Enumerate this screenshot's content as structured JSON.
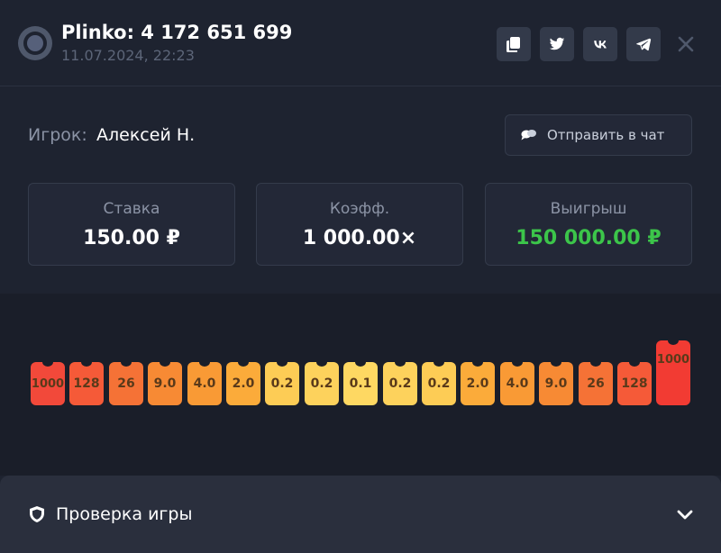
{
  "header": {
    "title": "Plinko: 4 172 651 699",
    "date": "11.07.2024, 22:23",
    "actions": [
      {
        "icon": "copy-icon"
      },
      {
        "icon": "twitter-icon"
      },
      {
        "icon": "vk-icon"
      },
      {
        "icon": "telegram-icon"
      }
    ],
    "close_icon": "close-icon"
  },
  "player": {
    "label": "Игрок:",
    "name": "Алексей Н.",
    "send_button": "Отправить в чат"
  },
  "stats": [
    {
      "label": "Ставка",
      "value": "150.00 ₽"
    },
    {
      "label": "Коэфф.",
      "value": "1 000.00×"
    },
    {
      "label": "Выигрыш",
      "value": "150 000.00 ₽"
    }
  ],
  "board": {
    "multipliers": [
      "1000",
      "128",
      "26",
      "9.0",
      "4.0",
      "2.0",
      "0.2",
      "0.2",
      "0.1",
      "0.2",
      "0.2",
      "2.0",
      "4.0",
      "9.0",
      "26",
      "128",
      "1000"
    ],
    "slot_colors": [
      "#f2493a",
      "#f55a38",
      "#f57236",
      "#f78a34",
      "#f99a35",
      "#fbab3a",
      "#fdcc55",
      "#fdd25c",
      "#fed862",
      "#fdd25c",
      "#fdcc55",
      "#fbab3a",
      "#f99a35",
      "#f78a34",
      "#f57236",
      "#f55a38",
      "#f2493a"
    ],
    "hit_slot_index": 16
  },
  "footer": {
    "title": "Проверка игры"
  },
  "colors": {
    "win": "#3cc54a",
    "background": "#1e2330",
    "card": "#232837"
  }
}
